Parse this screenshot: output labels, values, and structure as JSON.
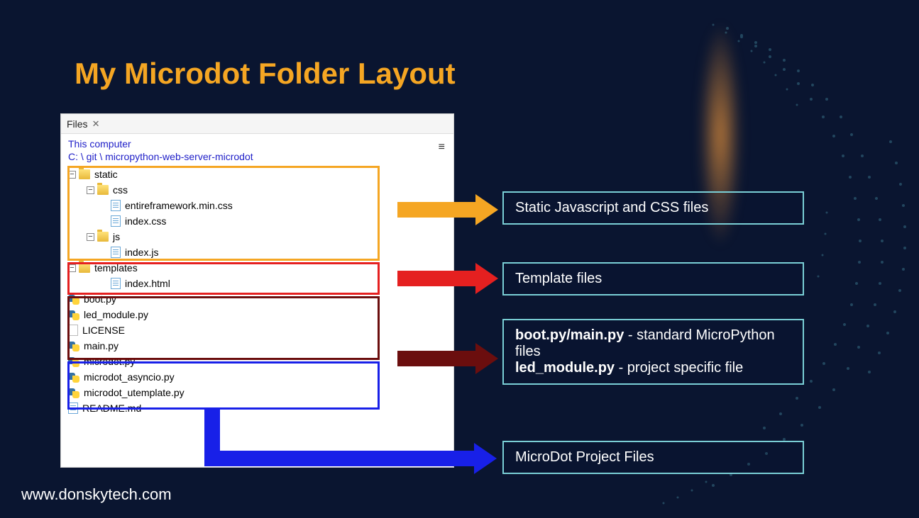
{
  "title": "My Microdot Folder Layout",
  "footer_url": "www.donskytech.com",
  "panel": {
    "tab_label": "Files",
    "computer_label": "This computer",
    "path": "C: \\ git \\ micropython-web-server-microdot"
  },
  "tree": {
    "static": "static",
    "css": "css",
    "entireframework": "entireframework.min.css",
    "index_css": "index.css",
    "js": "js",
    "index_js": "index.js",
    "templates": "templates",
    "index_html": "index.html",
    "boot_py": "boot.py",
    "led_module_py": "led_module.py",
    "license": "LICENSE",
    "main_py": "main.py",
    "microdot_py": "microdot.py",
    "microdot_asyncio_py": "microdot_asyncio.py",
    "microdot_utemplate_py": "microdot_utemplate.py",
    "readme": "README.md"
  },
  "callouts": {
    "static": "Static Javascript and CSS files",
    "templates": "Template files",
    "project_bold1": "boot.py/main.py",
    "project_text1": " - standard MicroPython files",
    "project_bold2": "led_module.py",
    "project_text2": " - project specific file",
    "microdot": "MicroDot Project Files"
  },
  "colors": {
    "orange": "#f5a623",
    "red": "#e52020",
    "darkred": "#6b0e0e",
    "blue": "#1820e8",
    "teal": "#7acfd6"
  }
}
